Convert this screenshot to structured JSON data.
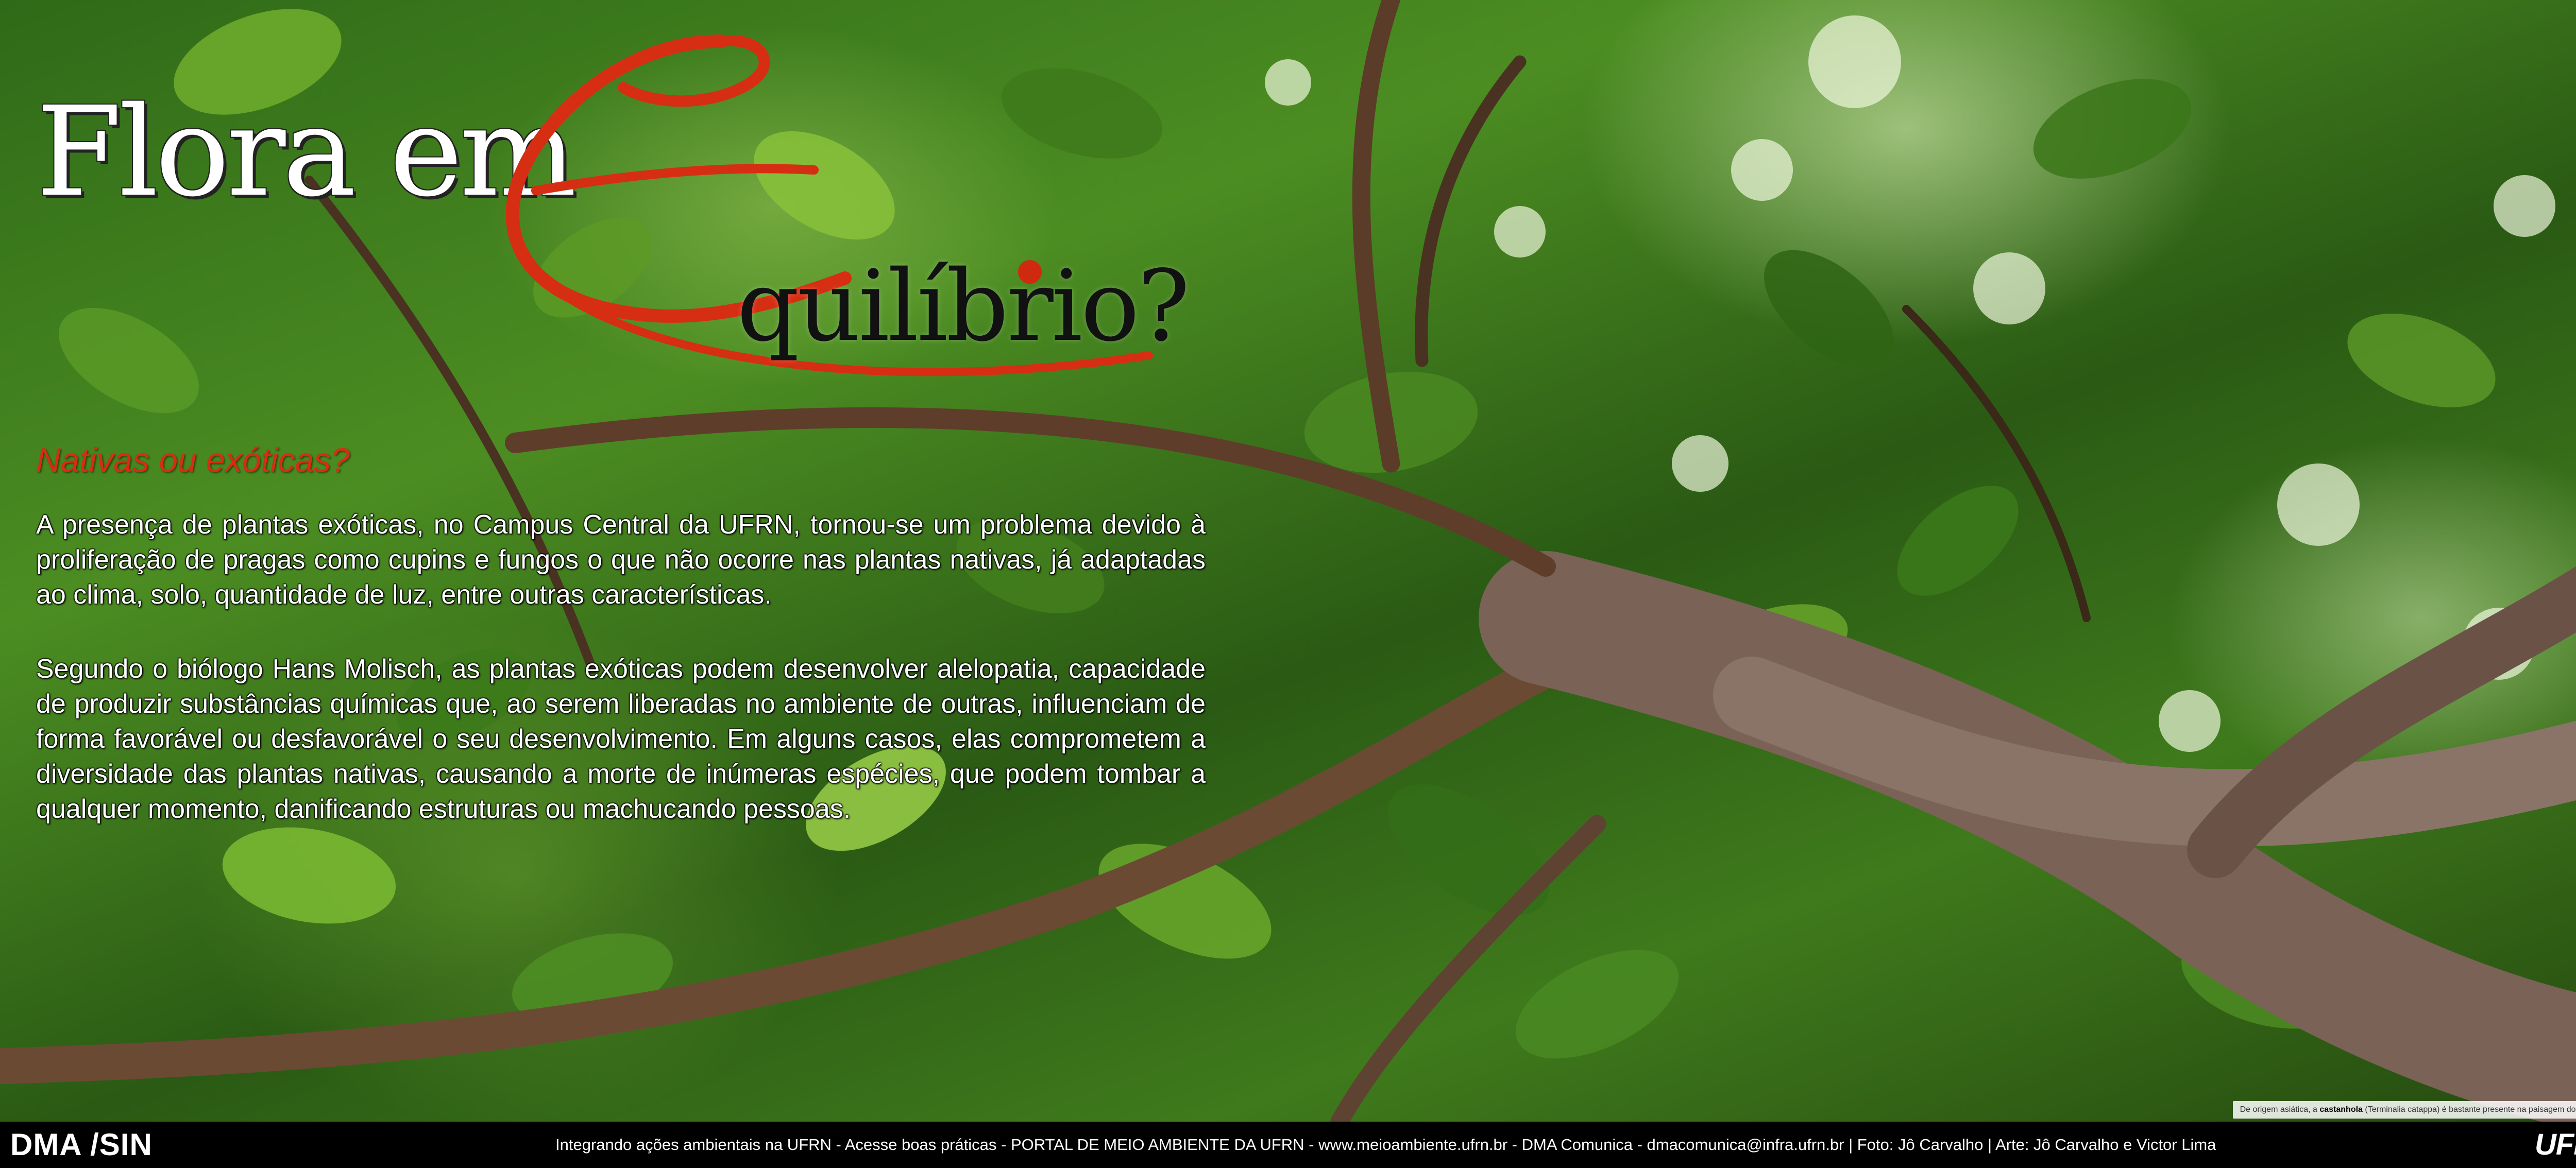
{
  "title": {
    "part1": "Flora em",
    "big_letter": "E",
    "part2": "quilíbrio?"
  },
  "subtitle": "Nativas ou exóticas?",
  "paragraphs": [
    "A presença de plantas exóticas, no Campus Central da UFRN, tornou-se um problema devido à proliferação de pragas como cupins e fungos o que não ocorre nas plantas nativas, já adaptadas ao clima, solo, quantidade de luz, entre outras características.",
    "Segundo o biólogo Hans Molisch, as plantas exóticas podem desenvolver alelopatia, capacidade de produzir substâncias químicas que, ao serem liberadas no ambiente de outras, influenciam de forma favorável ou desfavorável o seu desenvolvimento. Em alguns casos, elas comprometem a diversidade das plantas nativas, causando a morte de inúmeras espécies, que podem tombar a qualquer momento, danificando estruturas ou machucando pessoas."
  ],
  "caption": {
    "prefix": "De origem asiática, a",
    "plant": "castanhola",
    "suffix": "(Terminalia catappa) é bastante presente na paisagem do Campus."
  },
  "footer": {
    "brand": "DMA /SIN",
    "text": "Integrando ações ambientais na UFRN - Acesse boas práticas - PORTAL DE MEIO AMBIENTE DA UFRN - www.meioambiente.ufrn.br - DMA Comunica - dmacomunica@infra.ufrn.br | Foto: Jô Carvalho | Arte: Jô Carvalho e Victor Lima",
    "logo": "UFRN"
  },
  "colors": {
    "accent_red": "#d62e12",
    "footer_bg": "#000000",
    "text_white": "#ffffff"
  }
}
